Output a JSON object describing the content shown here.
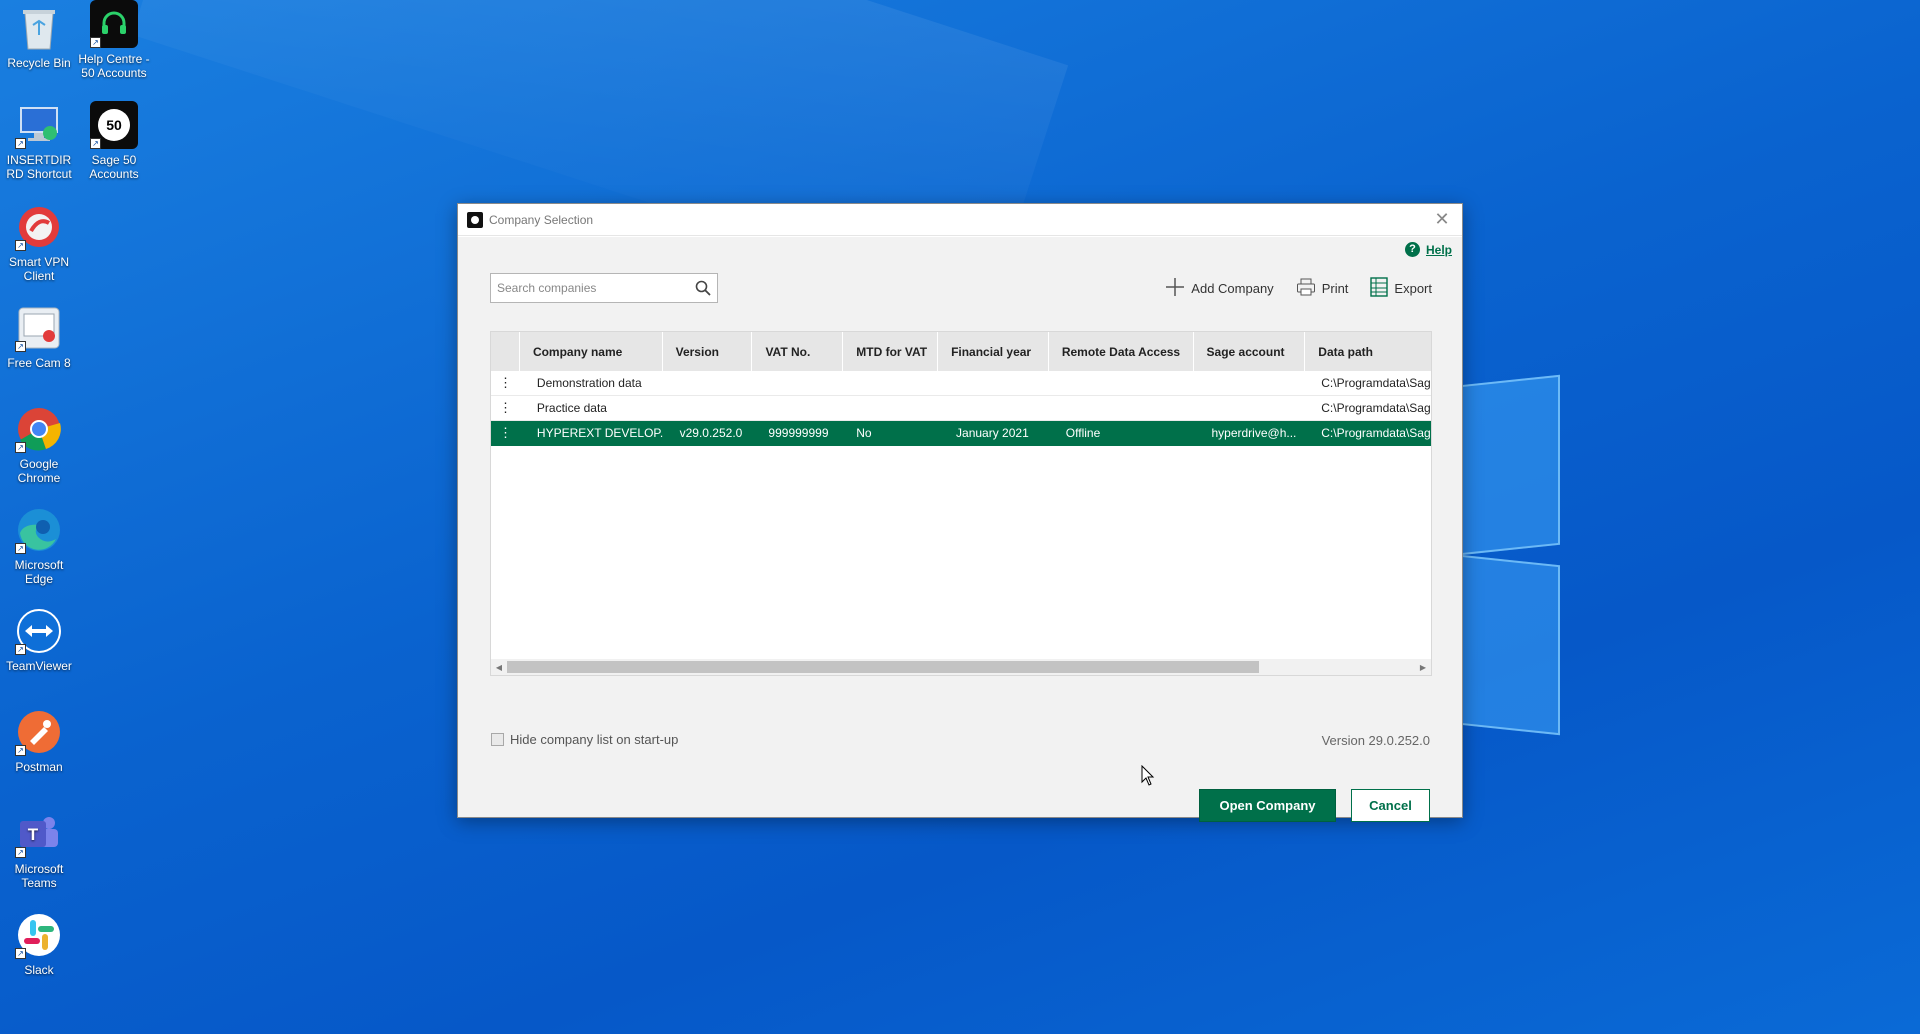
{
  "desktop": {
    "icons": [
      {
        "label": "Recycle Bin",
        "icon": "recycle-bin-icon"
      },
      {
        "label": "Help Centre - 50 Accounts",
        "icon": "headset-icon"
      },
      {
        "label": "INSERTDIR RD Shortcut",
        "icon": "remote-desktop-icon"
      },
      {
        "label": "Sage 50 Accounts",
        "icon": "sage50-icon"
      },
      {
        "label": "Smart VPN Client",
        "icon": "vpn-icon"
      },
      {
        "label": "Free Cam 8",
        "icon": "freecam-icon"
      },
      {
        "label": "Google Chrome",
        "icon": "chrome-icon"
      },
      {
        "label": "Microsoft Edge",
        "icon": "edge-icon"
      },
      {
        "label": "TeamViewer",
        "icon": "teamviewer-icon"
      },
      {
        "label": "Postman",
        "icon": "postman-icon"
      },
      {
        "label": "Microsoft Teams",
        "icon": "teams-icon"
      },
      {
        "label": "Slack",
        "icon": "slack-icon"
      }
    ],
    "sage_icon_text": "50"
  },
  "dialog": {
    "title": "Company Selection",
    "help_label": "Help",
    "search_placeholder": "Search companies",
    "toolbar": {
      "add_company": "Add Company",
      "print": "Print",
      "export": "Export"
    },
    "columns": [
      "Company name",
      "Version",
      "VAT No.",
      "MTD for VAT",
      "Financial year",
      "Remote Data Access",
      "Sage account",
      "Data path"
    ],
    "rows": [
      {
        "company": "Demonstration data",
        "version": "",
        "vat": "",
        "mtd": "",
        "fy": "",
        "remote": "",
        "account": "",
        "path": "C:\\Programdata\\Sage"
      },
      {
        "company": "Practice data",
        "version": "",
        "vat": "",
        "mtd": "",
        "fy": "",
        "remote": "",
        "account": "",
        "path": "C:\\Programdata\\Sage"
      },
      {
        "company": "HYPEREXT DEVELOP...",
        "version": "v29.0.252.0",
        "vat": "999999999",
        "mtd": "No",
        "fy": "January 2021",
        "remote": "Offline",
        "account": "hyperdrive@h...",
        "path": "C:\\Programdata\\Sage",
        "selected": true
      }
    ],
    "hide_on_startup_label": "Hide company list on start-up",
    "version_text": "Version 29.0.252.0",
    "open_button": "Open Company",
    "cancel_button": "Cancel"
  },
  "colors": {
    "sage_green": "#00704a",
    "desktop_blue": "#0a63cf"
  }
}
